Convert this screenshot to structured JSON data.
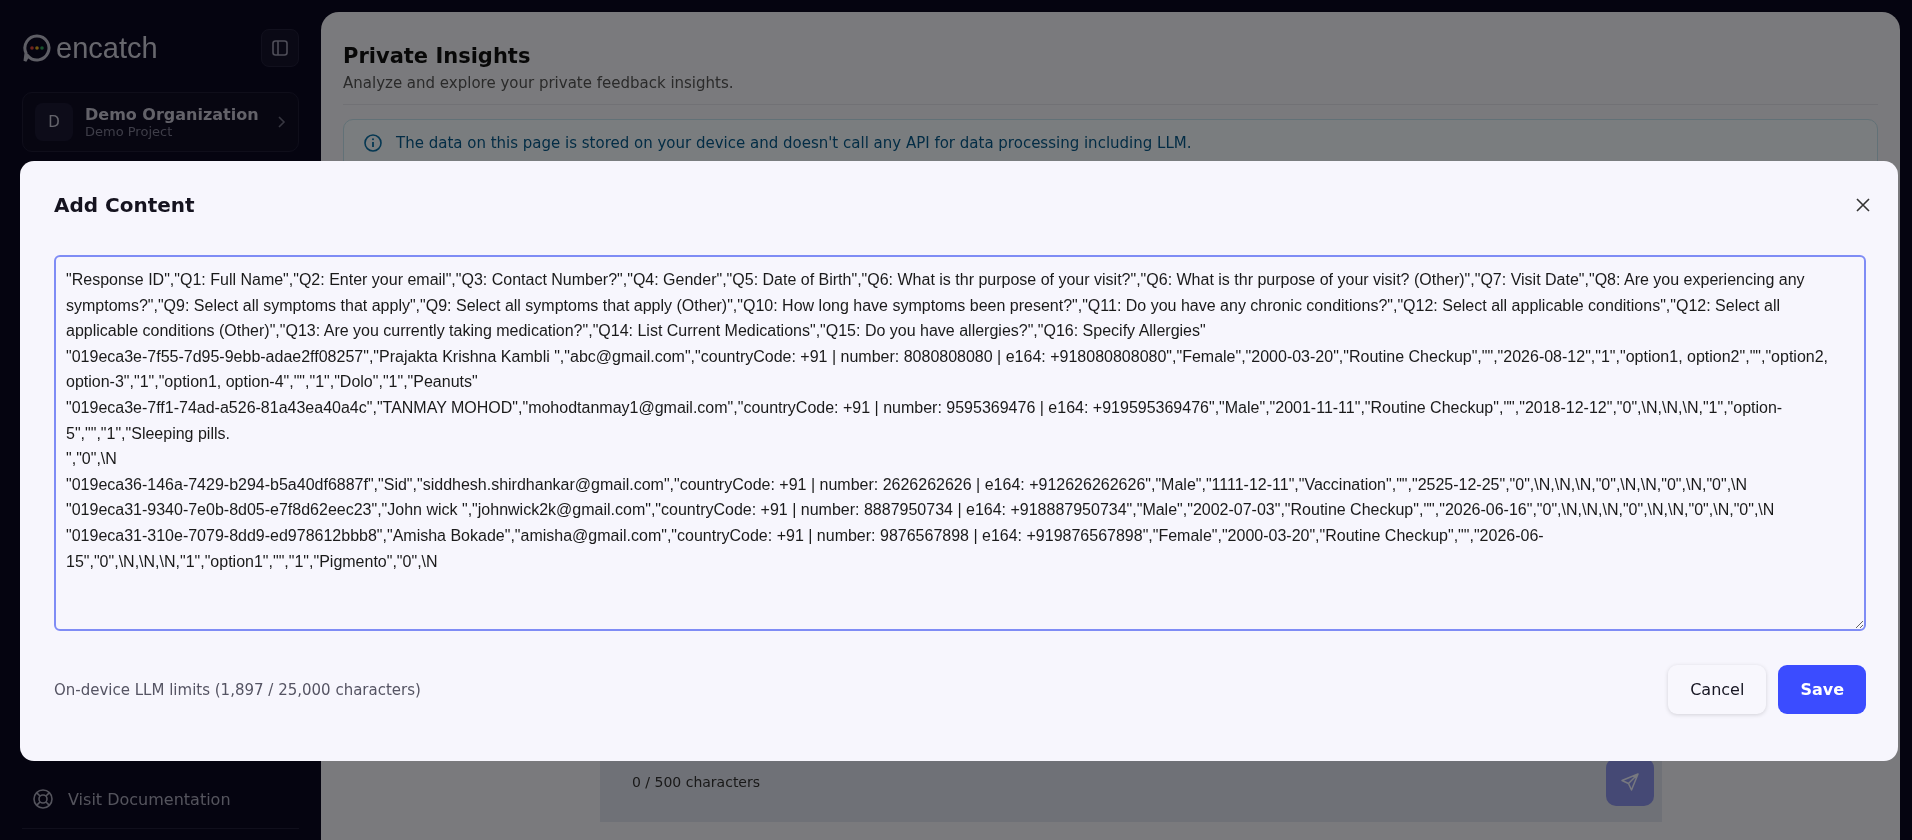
{
  "sidebar": {
    "logo_text": "encatch",
    "organization": {
      "initial": "D",
      "name": "Demo Organization",
      "project": "Demo Project"
    },
    "footer_links": [
      {
        "label": "Visit Documentation"
      }
    ]
  },
  "page": {
    "title": "Private Insights",
    "subtitle": "Analyze and explore your private feedback insights.",
    "info_banner": "The data on this page is stored on your device and doesn't call any API for data processing including LLM.",
    "composer": {
      "counter": "0 / 500 characters"
    }
  },
  "dialog": {
    "title": "Add Content",
    "content_lines": [
      "\"Response ID\",\"Q1: Full Name\",\"Q2: Enter your email\",\"Q3: Contact Number?\",\"Q4: Gender\",\"Q5: Date of Birth\",\"Q6: What is thr purpose of your visit?\",\"Q6: What is thr purpose of your visit? (Other)\",\"Q7: Visit Date\",\"Q8: Are you experiencing any symptoms?\",\"Q9: Select all symptoms that apply\",\"Q9: Select all symptoms that apply (Other)\",\"Q10: How long have symptoms been present?\",\"Q11: Do you have any chronic conditions?\",\"Q12: Select all applicable conditions\",\"Q12: Select all applicable conditions (Other)\",\"Q13: Are you currently taking medication?\",\"Q14: List Current Medications\",\"Q15: Do you have allergies?\",\"Q16: Specify Allergies\"",
      "\"019eca3e-7f55-7d95-9ebb-adae2ff08257\",\"Prajakta Krishna Kambli \",\"abc@gmail.com\",\"countryCode: +91 | number: 8080808080 | e164: +918080808080\",\"Female\",\"2000-03-20\",\"Routine Checkup\",\"\",\"2026-08-12\",\"1\",\"option1, option2\",\"\",\"option2, option-3\",\"1\",\"option1, option-4\",\"\",\"1\",\"Dolo\",\"1\",\"Peanuts\"",
      "\"019eca3e-7ff1-74ad-a526-81a43ea40a4c\",\"TANMAY MOHOD\",\"mohodtanmay1@gmail.com\",\"countryCode: +91 | number: 9595369476 | e164: +919595369476\",\"Male\",\"2001-11-11\",\"Routine Checkup\",\"\",\"2018-12-12\",\"0\",\\N,\\N,\\N,\"1\",\"option-5\",\"\",\"1\",\"Sleeping pills.",
      "\",\"0\",\\N",
      "\"019eca36-146a-7429-b294-b5a40df6887f\",\"Sid\",\"siddhesh.shirdhankar@gmail.com\",\"countryCode: +91 | number: 2626262626 | e164: +912626262626\",\"Male\",\"1111-12-11\",\"Vaccination\",\"\",\"2525-12-25\",\"0\",\\N,\\N,\\N,\"0\",\\N,\\N,\"0\",\\N,\"0\",\\N",
      "\"019eca31-9340-7e0b-8d05-e7f8d62eec23\",\"John wick \",\"johnwick2k@gmail.com\",\"countryCode: +91 | number: 8887950734 | e164: +918887950734\",\"Male\",\"2002-07-03\",\"Routine Checkup\",\"\",\"2026-06-16\",\"0\",\\N,\\N,\\N,\"0\",\\N,\\N,\"0\",\\N,\"0\",\\N",
      "\"019eca31-310e-7079-8dd9-ed978612bbb8\",\"Amisha Bokade\",\"amisha@gmail.com\",\"countryCode: +91 | number: 9876567898 | e164: +919876567898\",\"Female\",\"2000-03-20\",\"Routine Checkup\",\"\",\"2026-06-15\",\"0\",\\N,\\N,\\N,\"1\",\"option1\",\"\",\"1\",\"Pigmento\",\"0\",\\N"
    ],
    "limit_note": "On-device LLM limits (1,897 / 25,000 characters)",
    "buttons": [
      {
        "label": "Cancel",
        "kind": "secondary"
      },
      {
        "label": "Save",
        "kind": "primary"
      }
    ]
  }
}
